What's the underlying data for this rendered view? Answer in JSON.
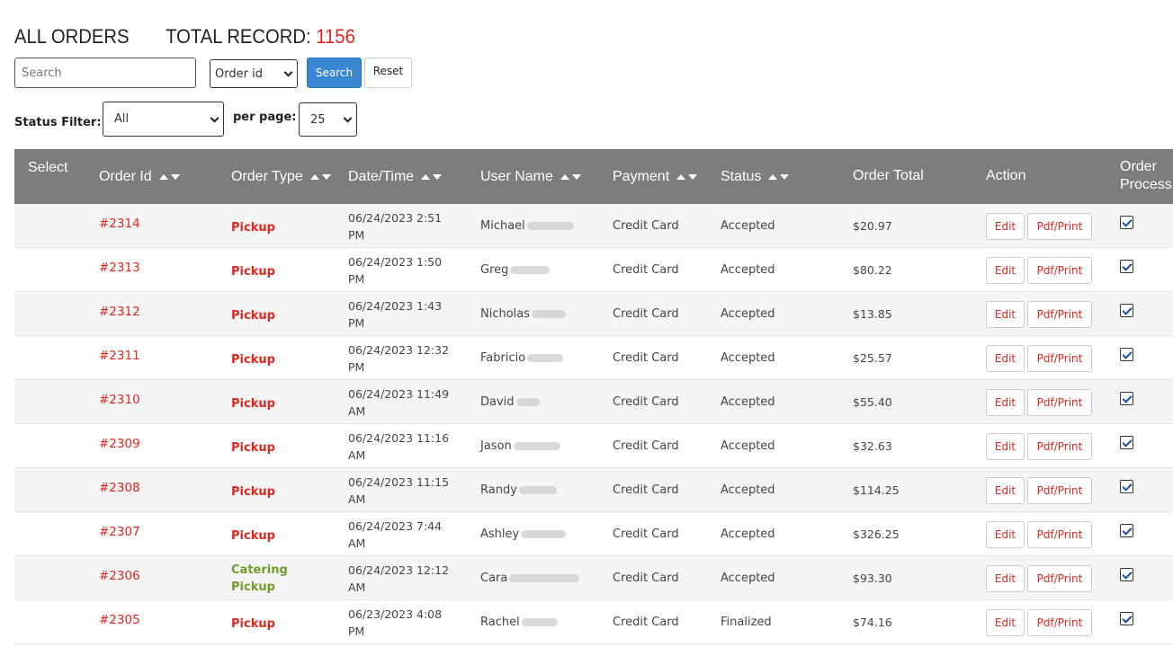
{
  "header": {
    "title": "ALL ORDERS",
    "total_label": "TOTAL RECORD:",
    "total_count": "1156"
  },
  "search": {
    "placeholder": "Search",
    "field_selected": "Order id",
    "search_label": "Search",
    "reset_label": "Reset"
  },
  "filters": {
    "status_label": "Status Filter:",
    "status_selected": "All",
    "per_page_label": "per page:",
    "per_page_selected": "25"
  },
  "table": {
    "columns": {
      "select": "Select",
      "order_id": "Order Id",
      "order_type": "Order Type",
      "datetime": "Date/Time",
      "user_name": "User Name",
      "payment": "Payment",
      "status": "Status",
      "order_total": "Order Total",
      "action": "Action",
      "order_process_1": "Order",
      "order_process_2": "Process"
    },
    "edit_label": "Edit",
    "pdf_label": "Pdf/Print",
    "rows": [
      {
        "id": "#2314",
        "type1": "Pickup",
        "type2": "",
        "date": "06/24/2023 2:51",
        "time": "PM",
        "user": "Michael",
        "payment": "Credit Card",
        "status": "Accepted",
        "total": "$20.97",
        "checked": true
      },
      {
        "id": "#2313",
        "type1": "Pickup",
        "type2": "",
        "date": "06/24/2023 1:50",
        "time": "PM",
        "user": "Greg",
        "payment": "Credit Card",
        "status": "Accepted",
        "total": "$80.22",
        "checked": true
      },
      {
        "id": "#2312",
        "type1": "Pickup",
        "type2": "",
        "date": "06/24/2023 1:43",
        "time": "PM",
        "user": "Nicholas",
        "payment": "Credit Card",
        "status": "Accepted",
        "total": "$13.85",
        "checked": true
      },
      {
        "id": "#2311",
        "type1": "Pickup",
        "type2": "",
        "date": "06/24/2023 12:32",
        "time": "PM",
        "user": "Fabricio",
        "payment": "Credit Card",
        "status": "Accepted",
        "total": "$25.57",
        "checked": true
      },
      {
        "id": "#2310",
        "type1": "Pickup",
        "type2": "",
        "date": "06/24/2023 11:49",
        "time": "AM",
        "user": "David",
        "payment": "Credit Card",
        "status": "Accepted",
        "total": "$55.40",
        "checked": true
      },
      {
        "id": "#2309",
        "type1": "Pickup",
        "type2": "",
        "date": "06/24/2023 11:16",
        "time": "AM",
        "user": "Jason",
        "payment": "Credit Card",
        "status": "Accepted",
        "total": "$32.63",
        "checked": true
      },
      {
        "id": "#2308",
        "type1": "Pickup",
        "type2": "",
        "date": "06/24/2023 11:15",
        "time": "AM",
        "user": "Randy",
        "payment": "Credit Card",
        "status": "Accepted",
        "total": "$114.25",
        "checked": true
      },
      {
        "id": "#2307",
        "type1": "Pickup",
        "type2": "",
        "date": "06/24/2023 7:44",
        "time": "AM",
        "user": "Ashley",
        "payment": "Credit Card",
        "status": "Accepted",
        "total": "$326.25",
        "checked": true
      },
      {
        "id": "#2306",
        "type1": "Catering",
        "type2": "Pickup",
        "date": "06/24/2023 12:12",
        "time": "AM",
        "user": "Cara",
        "payment": "Credit Card",
        "status": "Accepted",
        "total": "$93.30",
        "checked": true
      },
      {
        "id": "#2305",
        "type1": "Pickup",
        "type2": "",
        "date": "06/23/2023 4:08",
        "time": "PM",
        "user": "Rachel",
        "payment": "Credit Card",
        "status": "Finalized",
        "total": "$74.16",
        "checked": true
      }
    ]
  }
}
